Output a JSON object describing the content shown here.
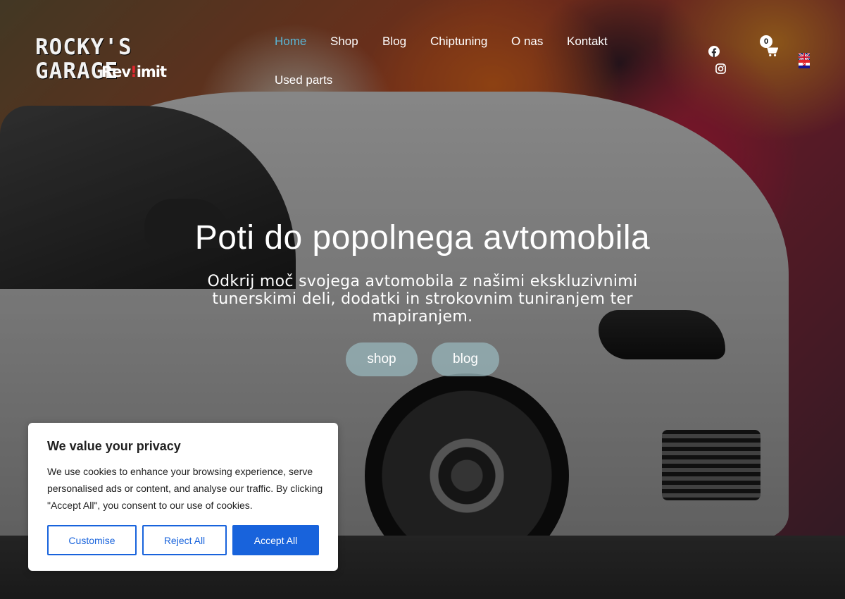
{
  "header": {
    "logo_title": "ROCKY'S GARAGE",
    "logo_sub_before": "Rev",
    "logo_sub_accent": "!",
    "logo_sub_after": "imit"
  },
  "nav": {
    "items": [
      {
        "label": "Home",
        "active": true
      },
      {
        "label": "Shop"
      },
      {
        "label": "Blog"
      },
      {
        "label": "Chiptuning"
      },
      {
        "label": "O nas"
      },
      {
        "label": "Kontakt"
      },
      {
        "label": "Used parts"
      }
    ]
  },
  "social": {
    "facebook": "facebook-icon",
    "instagram": "instagram-icon"
  },
  "cart": {
    "count": "0",
    "icon": "cart-icon"
  },
  "languages": [
    "english-flag",
    "croatian-flag"
  ],
  "hero": {
    "title": "Poti do popolnega avtomobila",
    "subtitle": "Odkrij moč svojega avtomobila z našimi ekskluzivnimi tunerskimi deli,  dodatki in strokovnim tuniranjem ter mapiranjem.",
    "buttons": {
      "shop": "shop",
      "blog": "blog"
    }
  },
  "cookie": {
    "title": "We value your privacy",
    "text": "We use cookies to enhance your browsing experience, serve personalised ads or content, and analyse our traffic. By clicking \"Accept All\", you consent to our use of cookies.",
    "customise": "Customise",
    "reject": "Reject All",
    "accept": "Accept All"
  },
  "colors": {
    "nav_active": "#5ab4d3",
    "cookie_accent": "#1863dc",
    "hero_button": "#96b4b9"
  }
}
